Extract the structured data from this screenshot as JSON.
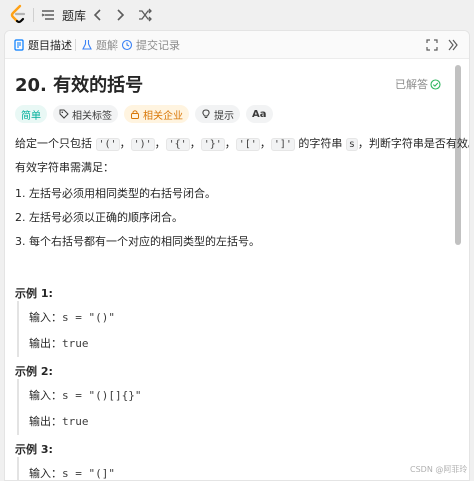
{
  "topbar": {
    "title": "题库",
    "icons": [
      "leetcode-logo",
      "list-icon",
      "chevron-left-icon",
      "chevron-right-icon",
      "shuffle-icon"
    ]
  },
  "tabs": {
    "description": "题目描述",
    "solution": "题解",
    "submissions": "提交记录"
  },
  "problem": {
    "title": "20. 有效的括号",
    "solved_label": "已解答",
    "tags": {
      "difficulty": "简单",
      "related": "相关标签",
      "company": "相关企业",
      "hint": "提示",
      "font": "Aa"
    },
    "description": {
      "intro_prefix": "给定一个只包括",
      "chars": [
        "'('",
        "')'",
        "'{'",
        "'}'",
        "'['",
        "']'"
      ],
      "sep": "，",
      "intro_mid": "的字符串",
      "var_s": "s",
      "intro_suffix": "，判断字符串是否有效。",
      "rules_head": "有效字符串需满足：",
      "rule1": "1. 左括号必须用相同类型的右括号闭合。",
      "rule2": "2. 左括号必须以正确的顺序闭合。",
      "rule3": "3. 每个右括号都有一个对应的相同类型的左括号。"
    },
    "examples": [
      {
        "heading": "示例 1:",
        "input_label": "输入：",
        "input": "s = \"()\"",
        "output_label": "输出：",
        "output": "true"
      },
      {
        "heading": "示例 2:",
        "input_label": "输入：",
        "input": "s = \"()[]{}\"",
        "output_label": "输出：",
        "output": "true"
      },
      {
        "heading": "示例 3:",
        "input_label": "输入：",
        "input": "s = \"(]\""
      }
    ]
  },
  "watermark": "CSDN @阿菲玲"
}
